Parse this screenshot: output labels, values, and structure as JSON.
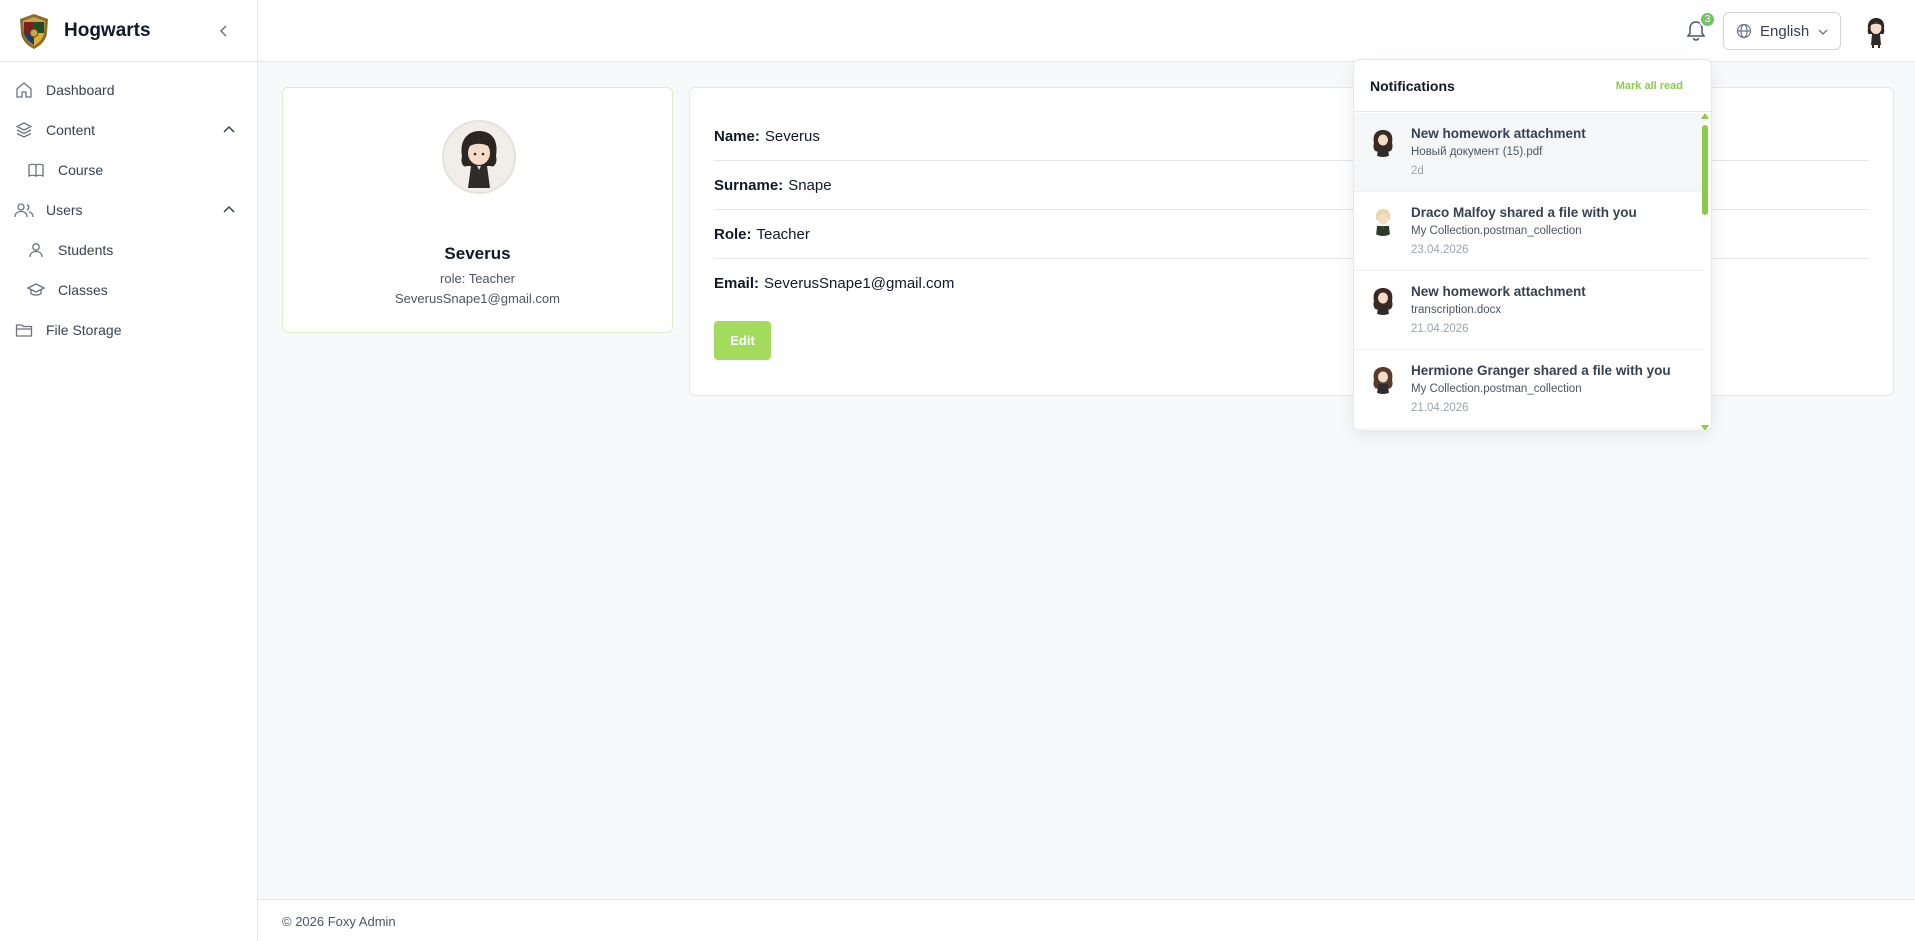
{
  "brand": {
    "name": "Hogwarts"
  },
  "sidebar": {
    "items": [
      {
        "label": "Dashboard",
        "icon": "home-icon"
      },
      {
        "label": "Content",
        "icon": "layers-icon",
        "expanded": true
      },
      {
        "label": "Course",
        "icon": "book-icon"
      },
      {
        "label": "Users",
        "icon": "users-icon",
        "expanded": true
      },
      {
        "label": "Students",
        "icon": "user-icon"
      },
      {
        "label": "Classes",
        "icon": "graduation-cap-icon"
      },
      {
        "label": "File Storage",
        "icon": "folder-icon"
      }
    ]
  },
  "header": {
    "notification_count": "3",
    "language": "English"
  },
  "profile": {
    "name": "Severus",
    "role_line": "role: Teacher",
    "email": "SeverusSnape1@gmail.com"
  },
  "details": {
    "name_key": "Name:",
    "name_val": "Severus",
    "surname_key": "Surname:",
    "surname_val": "Snape",
    "role_key": "Role:",
    "role_val": "Teacher",
    "email_key": "Email:",
    "email_val": "SeverusSnape1@gmail.com",
    "edit_label": "Edit"
  },
  "notifications": {
    "title": "Notifications",
    "mark_all": "Mark all read",
    "items": [
      {
        "title": "New homework attachment",
        "subtitle": "Новый документ (15).pdf",
        "date": "2d"
      },
      {
        "title": "Draco Malfoy shared a file with you",
        "subtitle": "My Collection.postman_collection",
        "date": "23.04.2026"
      },
      {
        "title": "New homework attachment",
        "subtitle": "transcription.docx",
        "date": "21.04.2026"
      },
      {
        "title": "Hermione Granger shared a file with you",
        "subtitle": "My Collection.postman_collection",
        "date": "21.04.2026"
      }
    ]
  },
  "footer": {
    "text": "© 2026 Foxy Admin"
  },
  "colors": {
    "accent": "#a3dc5d",
    "accent_text": "#8ccb4a",
    "badge": "#74c365"
  }
}
